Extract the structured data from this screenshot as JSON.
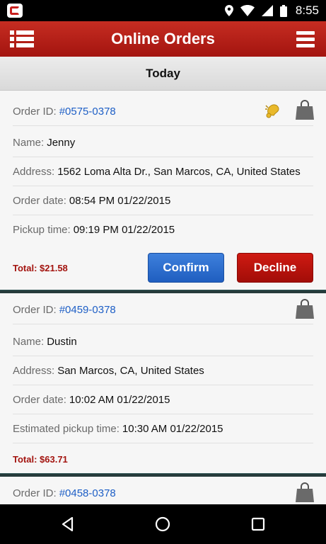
{
  "status_bar": {
    "time": "8:55",
    "icons": [
      "location-icon",
      "wifi-icon",
      "signal-icon",
      "battery-icon"
    ]
  },
  "header": {
    "title": "Online Orders",
    "left_icon": "list-icon",
    "right_icon": "menu-icon"
  },
  "section": {
    "title": "Today"
  },
  "orders": [
    {
      "order_label": "Order ID:",
      "order_id": "#0575-0378",
      "name_label": "Name:",
      "name": "Jenny",
      "address_label": "Address:",
      "address": "1562 Loma Alta Dr., San Marcos, CA, United States",
      "order_date_label": "Order date:",
      "order_date": "08:54 PM 01/22/2015",
      "pickup_label": "Pickup time:",
      "pickup": "09:19 PM 01/22/2015",
      "total": "Total: $21.58",
      "confirm_label": "Confirm",
      "decline_label": "Decline",
      "icons": [
        "bell-icon",
        "shopping-bag-icon"
      ]
    },
    {
      "order_label": "Order ID:",
      "order_id": "#0459-0378",
      "name_label": "Name:",
      "name": "Dustin",
      "address_label": "Address:",
      "address": "San Marcos, CA, United States",
      "order_date_label": "Order date:",
      "order_date": "10:02 AM 01/22/2015",
      "pickup_label": "Estimated pickup time:",
      "pickup": "10:30 AM 01/22/2015",
      "total": "Total: $63.71",
      "icons": [
        "shopping-bag-icon"
      ]
    },
    {
      "order_label": "Order ID:",
      "order_id": "#0458-0378",
      "icons": [
        "shopping-bag-icon"
      ]
    }
  ],
  "navbar": {
    "icons": [
      "back-icon",
      "home-icon",
      "recents-icon"
    ]
  },
  "colors": {
    "header": "#b01d16",
    "link": "#1e5fc6",
    "total": "#a3140f",
    "confirm": "#2a6acd",
    "decline": "#b8120c"
  }
}
